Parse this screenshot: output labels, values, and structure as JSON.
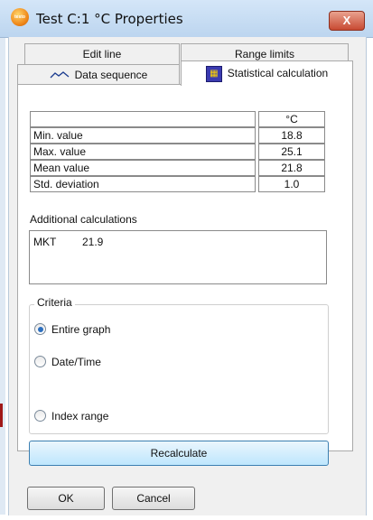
{
  "window": {
    "title": "Test C:1 °C Properties",
    "close_label": "X",
    "app_icon": "testo-logo-icon",
    "app_icon_text": "testo"
  },
  "tabs": {
    "row_back": [
      {
        "label": "Edit line"
      },
      {
        "label": "Range limits"
      }
    ],
    "row_front": [
      {
        "label": "Data sequence",
        "icon": "line-chart-icon"
      },
      {
        "label": "Statistical calculation",
        "icon": "statistics-icon",
        "active": true
      }
    ]
  },
  "stats": {
    "unit_header": "°C",
    "rows": [
      {
        "label": "Min. value",
        "value": "18.8"
      },
      {
        "label": "Max. value",
        "value": "25.1"
      },
      {
        "label": "Mean value",
        "value": "21.8"
      },
      {
        "label": "Std. deviation",
        "value": "1.0"
      }
    ]
  },
  "additional": {
    "label": "Additional calculations",
    "name": "MKT",
    "value": "21.9"
  },
  "criteria": {
    "label": "Criteria",
    "options": [
      {
        "label": "Entire graph",
        "selected": true
      },
      {
        "label": "Date/Time",
        "selected": false
      },
      {
        "label": "Index range",
        "selected": false
      }
    ]
  },
  "buttons": {
    "recalculate": "Recalculate",
    "ok": "OK",
    "cancel": "Cancel"
  },
  "colors": {
    "titlebar": "#c9def4",
    "close": "#c84a32",
    "accent_radio": "#2c6fbf",
    "recalc_border": "#3c7fb1"
  }
}
